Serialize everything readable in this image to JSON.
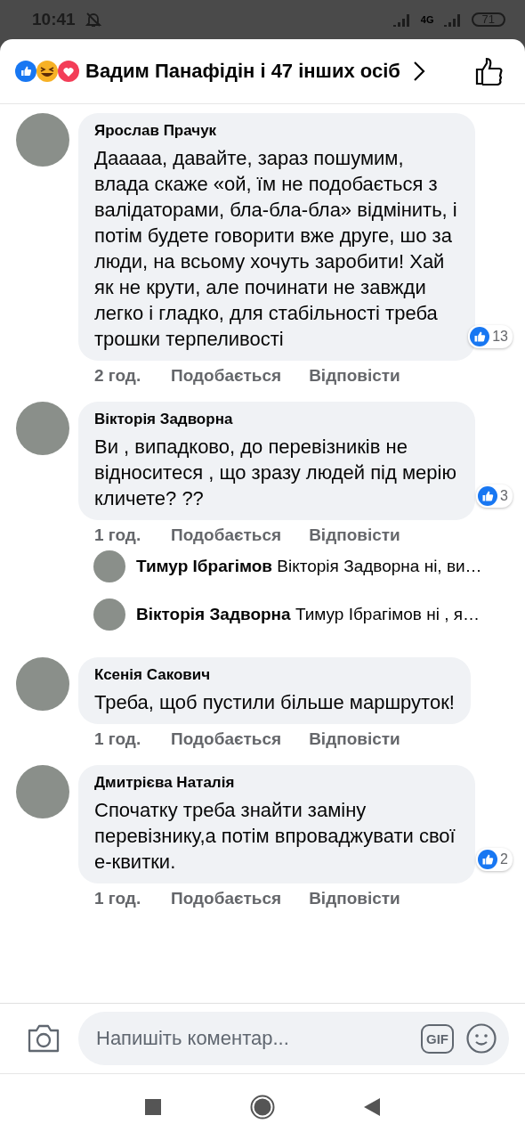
{
  "status_bar": {
    "time": "10:41",
    "network": "4G",
    "battery": "71"
  },
  "header": {
    "title": "Вадим Панафідін і 47 інших осіб"
  },
  "comments": [
    {
      "kind": "comment",
      "author": "Ярослав Прачук",
      "text": "Дааааа, давайте, зараз пошумим, влада скаже «ой, їм не подобається з валідаторами, бла-бла-бла» відмінить, і потім будете говорити вже друге, шо за люди, на всьому хочуть заробити! Хай як не крути, але починати не завжди легко і гладко, для стабільності треба трошки терпеливості",
      "time": "2 год.",
      "like": "Подобається",
      "reply": "Відповісти",
      "reactions": "13"
    },
    {
      "kind": "comment",
      "author": "Вікторія Задворна",
      "text": "Ви , випадково, до перевізників не відноситеся , що зразу людей під мерію кличете? ??",
      "time": "1 год.",
      "like": "Подобається",
      "reply": "Відповісти",
      "reactions": "3"
    },
    {
      "kind": "reply",
      "author": "Тимур Ібрагімов",
      "text": "Вікторія Задворна ні, ви…"
    },
    {
      "kind": "reply",
      "author": "Вікторія Задворна",
      "text": "Тимур Ібрагімов ні , я…"
    },
    {
      "kind": "comment",
      "author": "Ксенія Сакович",
      "text": "Треба, щоб пустили більше маршруток!",
      "time": "1 год.",
      "like": "Подобається",
      "reply": "Відповісти"
    },
    {
      "kind": "comment",
      "author": "Дмитрієва Наталія",
      "text": "Спочатку треба знайти заміну перевізнику,а потім впроваджувати свої  е-квитки.",
      "time": "1 год.",
      "like": "Подобається",
      "reply": "Відповісти",
      "reactions": "2"
    }
  ],
  "composer": {
    "placeholder": "Напишіть коментар...",
    "gif": "GIF"
  }
}
